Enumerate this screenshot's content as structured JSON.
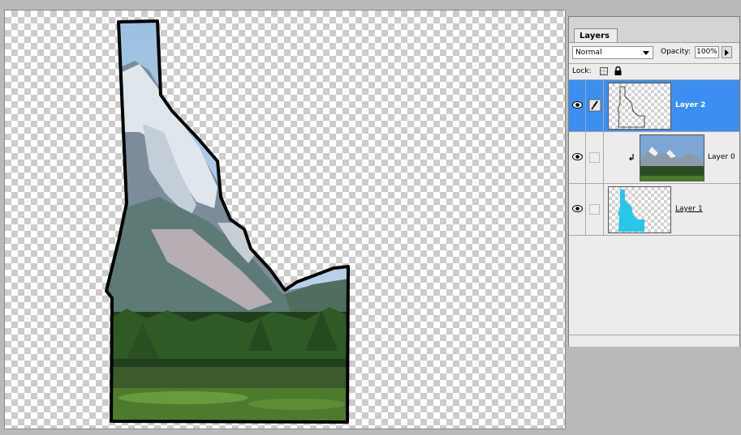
{
  "palette": {
    "tab_label": "Layers",
    "blend_mode": "Normal",
    "opacity_label": "Opacity:",
    "opacity_value": "100%",
    "lock_label": "Lock:"
  },
  "layers": [
    {
      "name": "Layer 2",
      "selected": true
    },
    {
      "name": "Layer 0",
      "selected": false
    },
    {
      "name": "Layer 1",
      "selected": false
    }
  ],
  "colors": {
    "selection": "#3b8ff0",
    "layer1_fill": "#2bc5e8",
    "outline": "#000000"
  },
  "icons": [
    "eye-icon",
    "brush-icon",
    "lock-transparent-icon",
    "lock-all-icon",
    "clip-arrow-icon",
    "blend-dropdown-icon",
    "opacity-slider-icon"
  ]
}
